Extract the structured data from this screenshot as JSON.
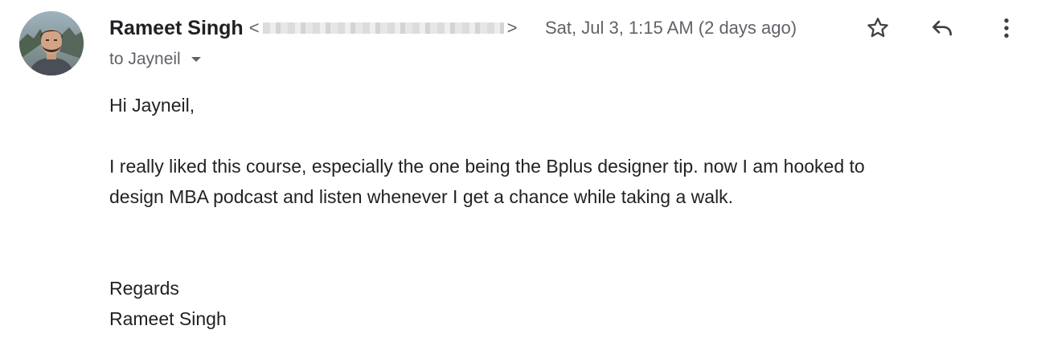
{
  "sender": {
    "name": "Rameet Singh",
    "email_open": "<",
    "email_close": ">"
  },
  "date": "Sat, Jul 3, 1:15 AM (2 days ago)",
  "recipient_line": "to Jayneil",
  "body": {
    "greeting": "Hi Jayneil,",
    "paragraph_line1": "I really liked this course, especially the one being the Bplus designer tip. now I am hooked to",
    "paragraph_line2": "design MBA podcast and listen whenever I get a chance while taking a walk.",
    "closing": "Regards",
    "signature": "Rameet Singh"
  },
  "icons": {
    "star": "star-icon",
    "reply": "reply-icon",
    "more": "more-vert-icon",
    "caret": "caret-down-icon"
  },
  "colors": {
    "primary_text": "#202124",
    "secondary_text": "#5f6368",
    "icon": "#5f6368"
  }
}
